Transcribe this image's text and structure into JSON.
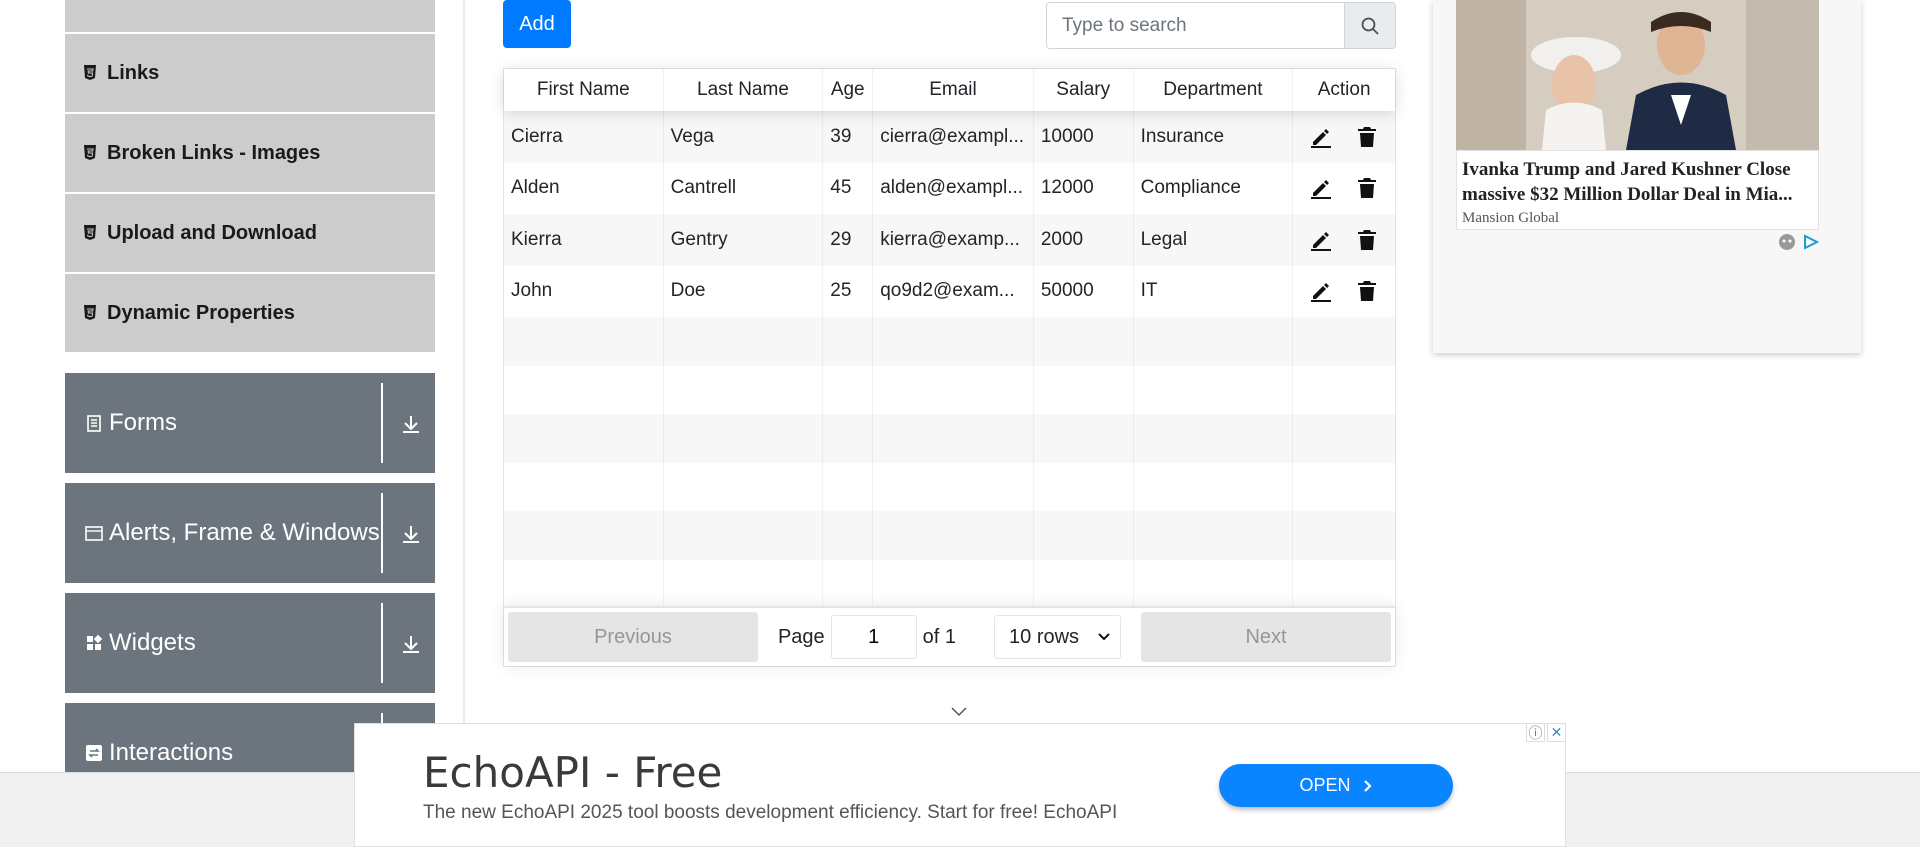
{
  "sidebar": {
    "elements_items": [
      {
        "label": "Links"
      },
      {
        "label": "Broken Links - Images"
      },
      {
        "label": "Upload and Download"
      },
      {
        "label": "Dynamic Properties"
      }
    ],
    "groups": [
      {
        "label": "Forms"
      },
      {
        "label": "Alerts, Frame & Windows"
      },
      {
        "label": "Widgets"
      },
      {
        "label": "Interactions"
      }
    ]
  },
  "toolbar": {
    "add_label": "Add",
    "search_placeholder": "Type to search"
  },
  "table": {
    "columns": [
      "First Name",
      "Last Name",
      "Age",
      "Email",
      "Salary",
      "Department",
      "Action"
    ],
    "rows": [
      {
        "first": "Cierra",
        "last": "Vega",
        "age": "39",
        "email": "cierra@exampl...",
        "salary": "10000",
        "dept": "Insurance"
      },
      {
        "first": "Alden",
        "last": "Cantrell",
        "age": "45",
        "email": "alden@exampl...",
        "salary": "12000",
        "dept": "Compliance"
      },
      {
        "first": "Kierra",
        "last": "Gentry",
        "age": "29",
        "email": "kierra@examp...",
        "salary": "2000",
        "dept": "Legal"
      },
      {
        "first": "John",
        "last": "Doe",
        "age": "25",
        "email": "qo9d2@exam...",
        "salary": "50000",
        "dept": "IT"
      }
    ]
  },
  "pagination": {
    "previous_label": "Previous",
    "next_label": "Next",
    "page_label": "Page",
    "page_value": "1",
    "of_label": "of 1",
    "rows_option": "10 rows"
  },
  "right_ad": {
    "headline": "Ivanka Trump and Jared Kushner Close massive $32 Million Dollar Deal in Mia...",
    "source": "Mansion Global"
  },
  "bottom_ad": {
    "title": "EchoAPI - Free",
    "description": "The new EchoAPI 2025 tool boosts development efficiency. Start for free! EchoAPI",
    "cta": "OPEN"
  },
  "colors": {
    "primary": "#007bff",
    "sidebar_item_bg": "#cccccc",
    "group_header_bg": "#6c757d"
  }
}
